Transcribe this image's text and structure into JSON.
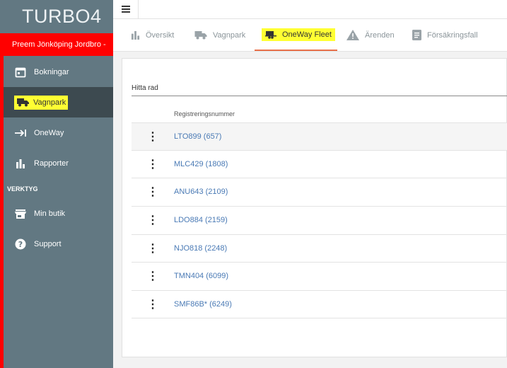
{
  "app": {
    "brand": "TURBO4",
    "store_name": "Preem Jönköping Jordbro -"
  },
  "sidebar": {
    "items": [
      {
        "label": "Bokningar",
        "icon": "calendar-icon"
      },
      {
        "label": "Vagnpark",
        "icon": "truck-icon",
        "active": true
      },
      {
        "label": "OneWay",
        "icon": "arrow-to-bar-icon"
      },
      {
        "label": "Rapporter",
        "icon": "bar-chart-icon"
      }
    ],
    "section_label": "VERKTYG",
    "tools": [
      {
        "label": "Min butik",
        "icon": "store-icon"
      },
      {
        "label": "Support",
        "icon": "help-icon"
      }
    ]
  },
  "tabs": [
    {
      "label": "Översikt",
      "icon": "bar-chart-icon"
    },
    {
      "label": "Vagnpark",
      "icon": "truck-icon"
    },
    {
      "label": "OneWay Fleet",
      "icon": "trailer-icon",
      "active": true
    },
    {
      "label": "Ärenden",
      "icon": "warning-icon"
    },
    {
      "label": "Försäkringsfall",
      "icon": "document-icon"
    }
  ],
  "table": {
    "filter_label": "Hitta rad",
    "column_header": "Registreringsnummer",
    "rows": [
      "LTO899 (657)",
      "MLC429 (1808)",
      "ANU643 (2109)",
      "LDO884 (2159)",
      "NJO818 (2248)",
      "TMN404 (6099)",
      "SMF86B* (6249)"
    ]
  },
  "colors": {
    "sidebar": "#627882",
    "accent_red": "#ff0000",
    "tab_active": "#e8704a",
    "link": "#4a7ab5",
    "highlight": "#ffff33"
  }
}
